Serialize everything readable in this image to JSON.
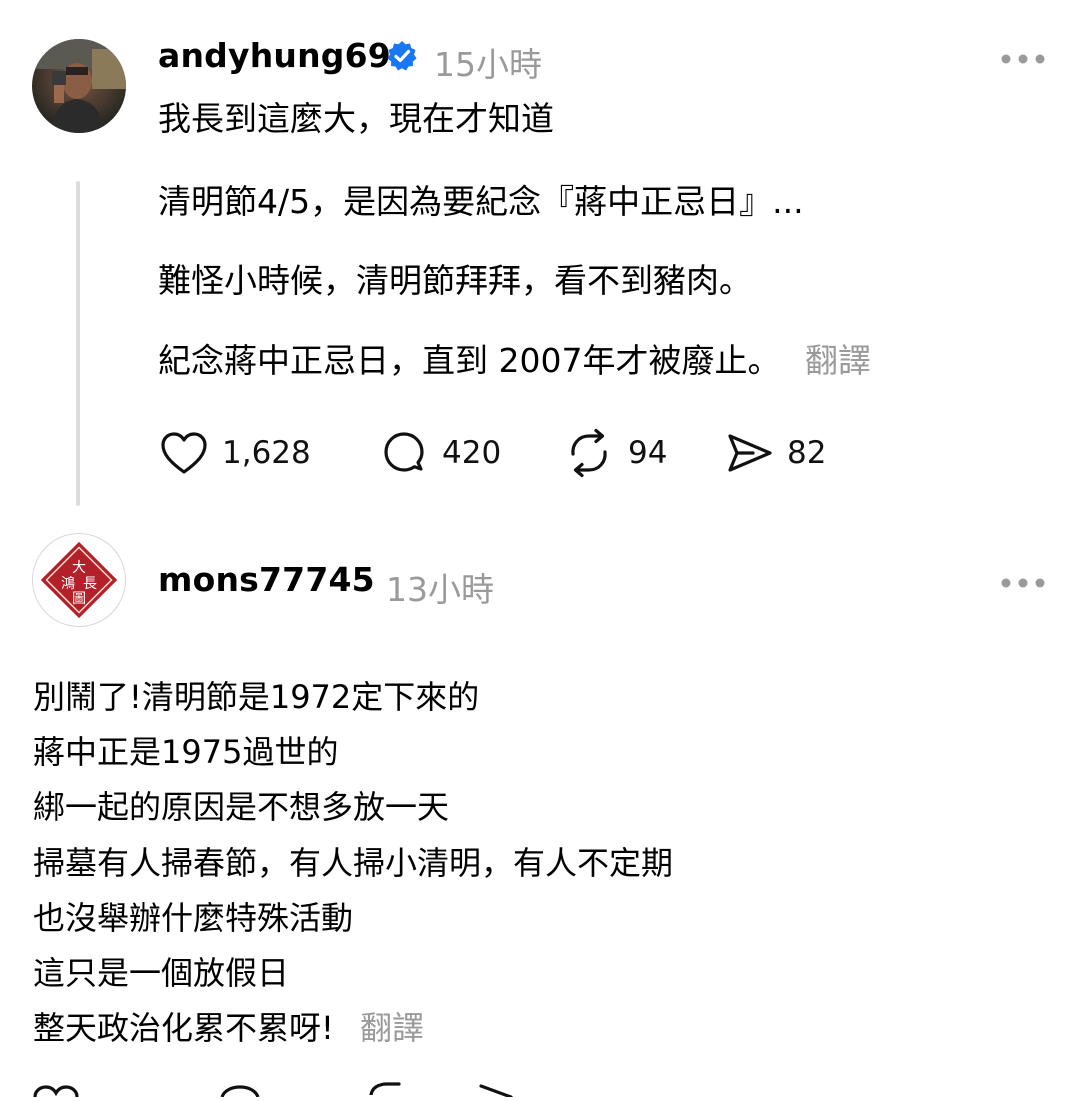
{
  "post": {
    "username": "andyhung69",
    "verified_icon": "verified-badge-icon",
    "time": "15小時",
    "more_icon": "more-horizontal-icon",
    "line1": "我長到這麼大，現在才知道",
    "line2": "清明節4/5，是因為要紀念『蔣中正忌日』...",
    "line3": "難怪小時候，清明節拜拜，看不到豬肉。",
    "line4": "紀念蔣中正忌日，直到 2007年才被廢止。",
    "translate": "翻譯",
    "actions": {
      "likes": "1,628",
      "comments": "420",
      "reposts": "94",
      "shares": "82"
    }
  },
  "reply": {
    "username": "mons77745",
    "time": "13小時",
    "more_icon": "more-horizontal-icon",
    "avatar_text": [
      "大",
      "長",
      "鴻",
      "圖"
    ],
    "lines": [
      "別鬧了!清明節是1972定下來的",
      "蔣中正是1975過世的",
      "綁一起的原因是不想多放一天",
      "掃墓有人掃春節，有人掃小清明，有人不定期",
      "也沒舉辦什麼特殊活動",
      "這只是一個放假日",
      "整天政治化累不累呀!"
    ],
    "translate": "翻譯"
  },
  "colors": {
    "verified": "#1877f2",
    "muted": "#9a9a9a",
    "seal_red": "#b3202a"
  }
}
